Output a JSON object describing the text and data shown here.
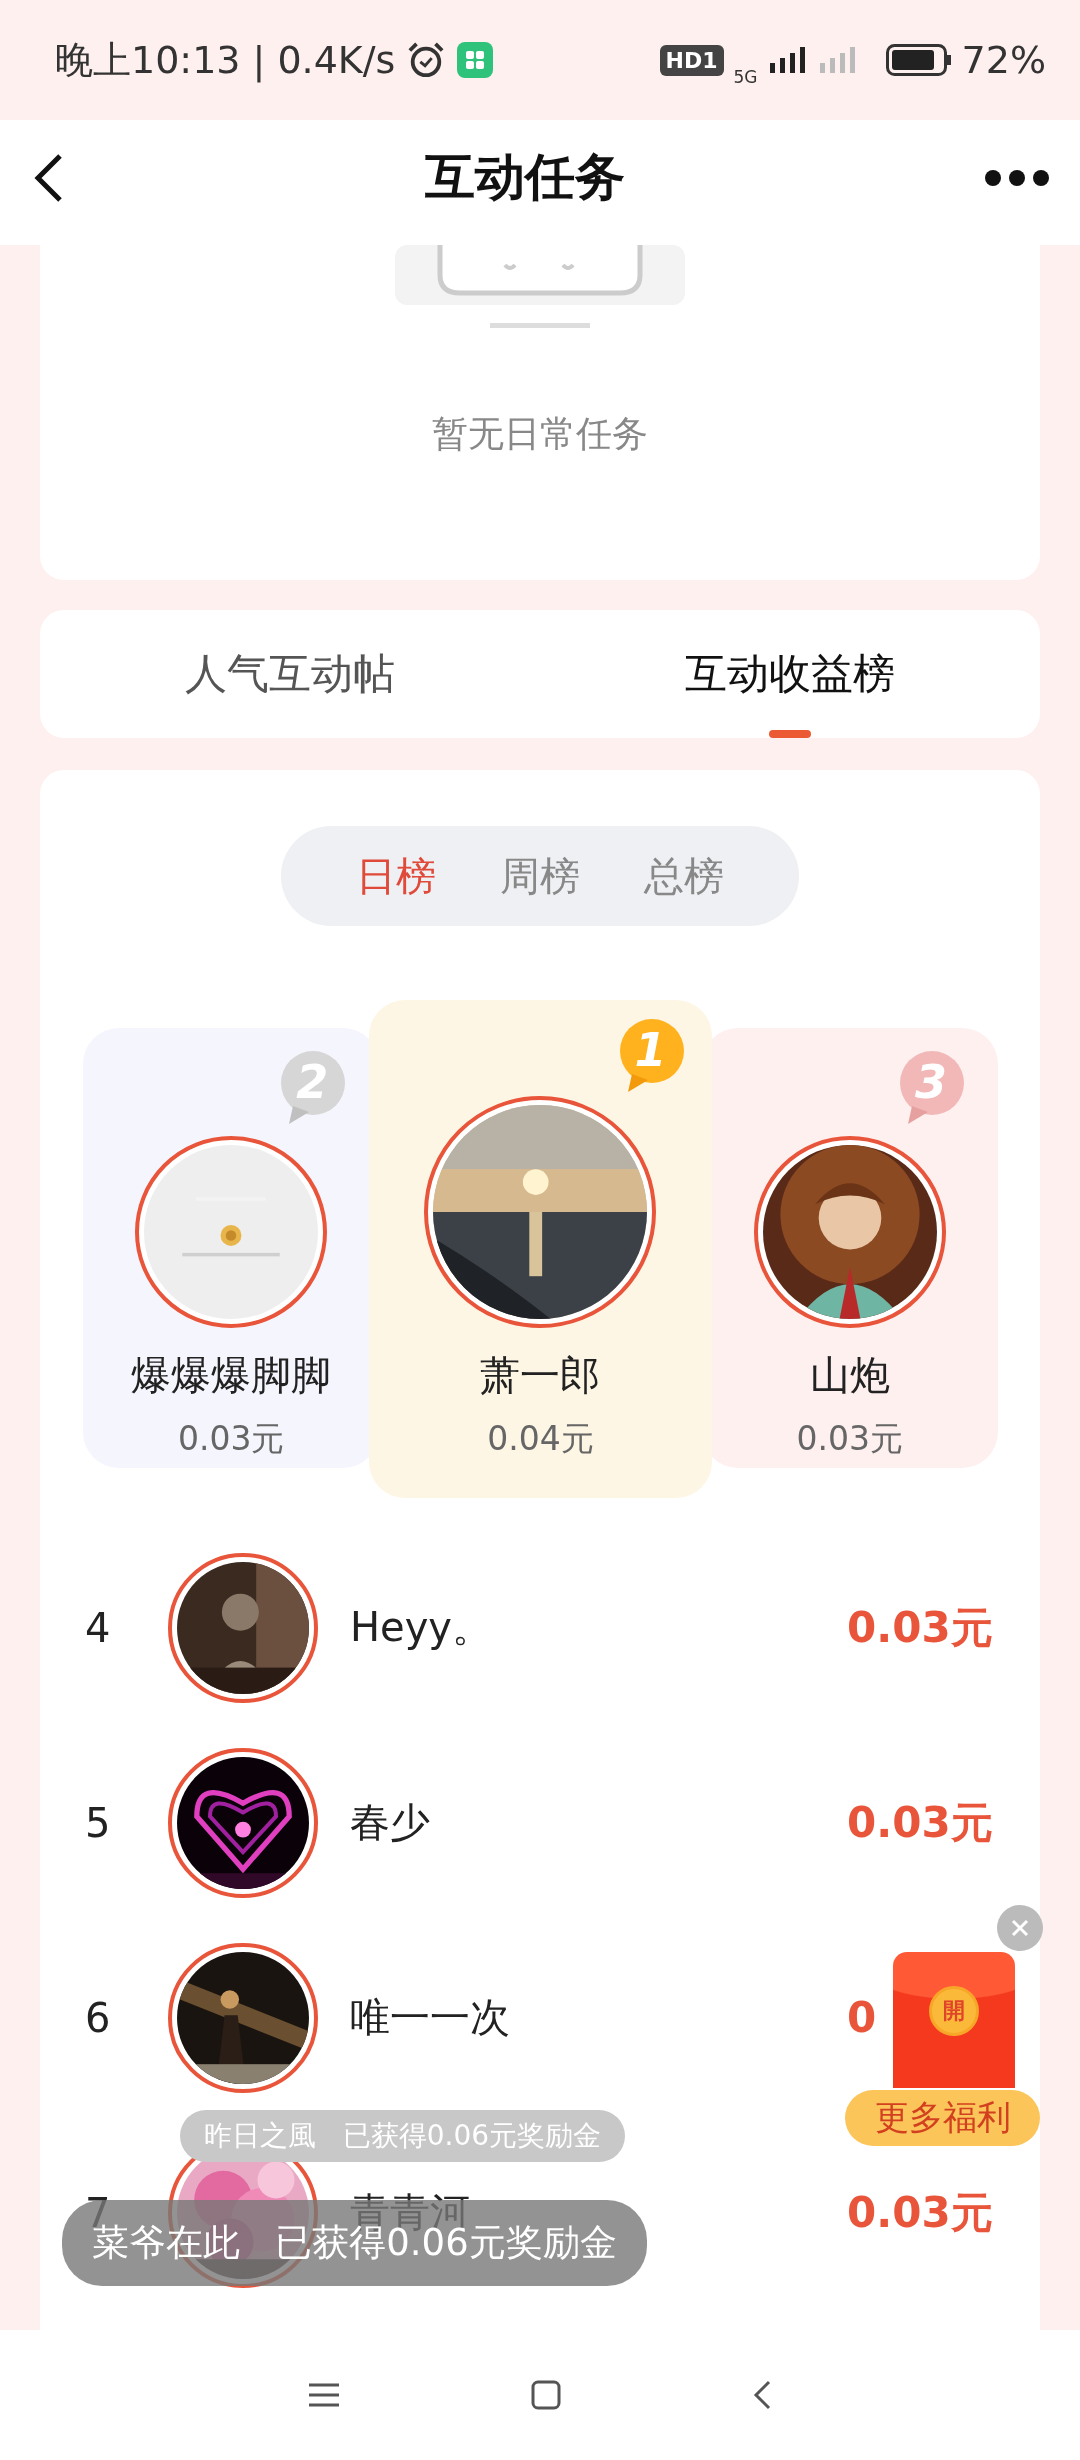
{
  "status_bar": {
    "time": "晚上10:13",
    "speed": "| 0.4K/s",
    "hd_badge": "HD1",
    "network": "5G",
    "battery": "72%"
  },
  "header": {
    "title": "互动任务"
  },
  "daily_tasks": {
    "empty_text": "暂无日常任务"
  },
  "tabs": [
    {
      "label": "人气互动帖",
      "selected": false
    },
    {
      "label": "互动收益榜",
      "selected": true
    }
  ],
  "periods": [
    {
      "label": "日榜",
      "selected": true
    },
    {
      "label": "周榜",
      "selected": false
    },
    {
      "label": "总榜",
      "selected": false
    }
  ],
  "podium": [
    {
      "kind": "silver",
      "rank": "2",
      "name": "爆爆爆脚脚",
      "amount": "0.03元"
    },
    {
      "kind": "gold",
      "rank": "1",
      "name": "萧一郎",
      "amount": "0.04元"
    },
    {
      "kind": "bronze",
      "rank": "3",
      "name": "山炮",
      "amount": "0.03元"
    }
  ],
  "ranking": [
    {
      "rank": "4",
      "name": "Heyy。",
      "amount": "0.03元"
    },
    {
      "rank": "5",
      "name": "春少",
      "amount": "0.03元"
    },
    {
      "rank": "6",
      "name": "唯一一次",
      "amount": "0"
    },
    {
      "rank": "7",
      "name": "青青河",
      "amount": "0.03元"
    }
  ],
  "toasts": [
    {
      "kind": "fading",
      "text": "昨日之風   已获得0.06元奖励金"
    },
    {
      "kind": "solid",
      "text": "菜爷在此   已获得0.06元奖励金"
    }
  ],
  "reward_popup": {
    "seal": "開",
    "label": "更多福利"
  }
}
